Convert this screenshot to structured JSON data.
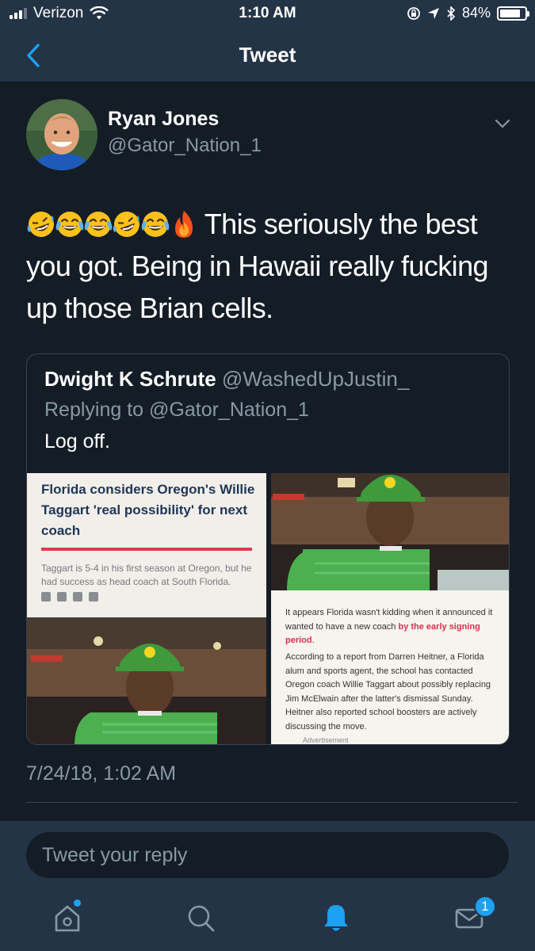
{
  "status_bar": {
    "carrier": "Verizon",
    "time": "1:10 AM",
    "battery": "84%",
    "battery_level": 0.84
  },
  "nav": {
    "title": "Tweet",
    "back_icon": "chevron-left-icon"
  },
  "tweet": {
    "author_name": "Ryan Jones",
    "author_handle": "@Gator_Nation_1",
    "emojis": [
      "rofl",
      "joy",
      "joy",
      "rofl",
      "joy",
      "fire"
    ],
    "text": " This seriously the best you got. Being in Hawaii really fucking up those Brian cells.",
    "timestamp": "7/24/18, 1:02 AM"
  },
  "quoted": {
    "name": "Dwight K Schrute",
    "handle": "@WashedUpJustin_",
    "replying_to": "Replying to @Gator_Nation_1",
    "text": "Log off.",
    "article": {
      "headline": "Florida considers Oregon's Willie Taggart 'real possibility' for next coach",
      "subhead": "Taggart is 5-4 in his first season at Oregon, but he had success as head coach at South Florida.",
      "p1_start": "It appears Florida wasn't kidding when it announced it wanted to have a new coach ",
      "p1_link": "by the early signing period",
      "p1_end": ".",
      "p2": "According to a report from Darren Heitner, a Florida alum and sports agent, the school has contacted Oregon coach Willie Taggart about possibly replacing Jim McElwain after the latter's dismissal Sunday. Heitner also reported school boosters are actively discussing the move.",
      "ad_label": "Advertisement"
    }
  },
  "reply": {
    "placeholder": "Tweet your reply"
  },
  "tabs": {
    "items": [
      "home-icon",
      "search-icon",
      "notifications-icon",
      "messages-icon"
    ],
    "messages_badge": "1"
  },
  "colors": {
    "background": "#141d26",
    "bar": "#243447",
    "accent": "#1da1f2",
    "muted": "#8899a6"
  }
}
